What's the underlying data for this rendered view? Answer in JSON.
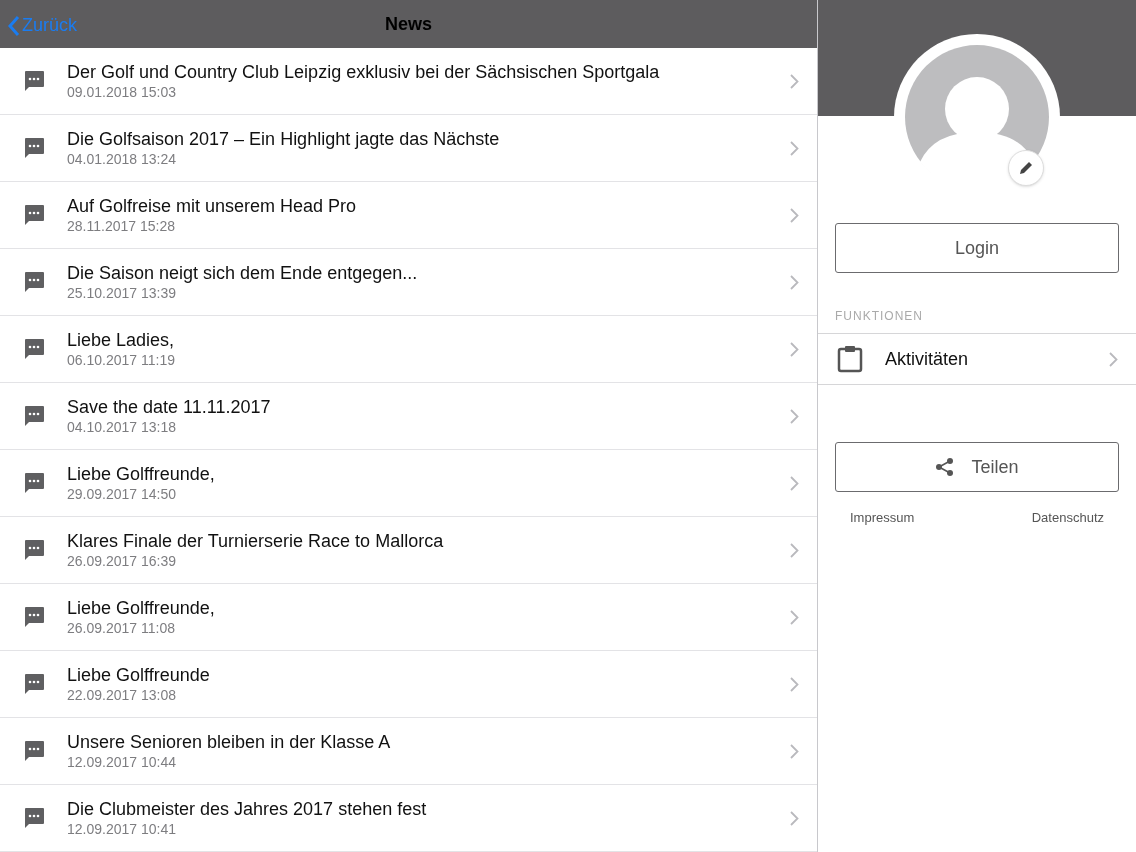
{
  "nav_bar": {
    "back_label": "Zurück",
    "title": "News"
  },
  "news": [
    {
      "title": "Der Golf und Country Club Leipzig exklusiv bei der Sächsischen Sportgala",
      "date": "09.01.2018 15:03"
    },
    {
      "title": "Die Golfsaison 2017 – Ein Highlight jagte das Nächste",
      "date": "04.01.2018 13:24"
    },
    {
      "title": "Auf Golfreise mit unserem Head Pro",
      "date": "28.11.2017 15:28"
    },
    {
      "title": "Die Saison neigt sich dem Ende entgegen...",
      "date": "25.10.2017 13:39"
    },
    {
      "title": "Liebe Ladies,",
      "date": "06.10.2017 11:19"
    },
    {
      "title": "Save the date 11.11.2017",
      "date": "04.10.2017 13:18"
    },
    {
      "title": "Liebe Golffreunde,",
      "date": "29.09.2017 14:50"
    },
    {
      "title": "Klares Finale der Turnierserie Race to Mallorca",
      "date": "26.09.2017 16:39"
    },
    {
      "title": "Liebe Golffreunde,",
      "date": "26.09.2017 11:08"
    },
    {
      "title": "Liebe Golffreunde",
      "date": "22.09.2017 13:08"
    },
    {
      "title": "Unsere Senioren bleiben in der Klasse A",
      "date": "12.09.2017 10:44"
    },
    {
      "title": "Die Clubmeister des Jahres 2017 stehen fest",
      "date": "12.09.2017 10:41"
    }
  ],
  "profile": {
    "login_button": "Login",
    "section_header": "FUNKTIONEN",
    "functions": [
      {
        "label": "Aktivitäten"
      }
    ],
    "share_button": "Teilen",
    "links": [
      "Impressum",
      "Datenschutz"
    ]
  }
}
